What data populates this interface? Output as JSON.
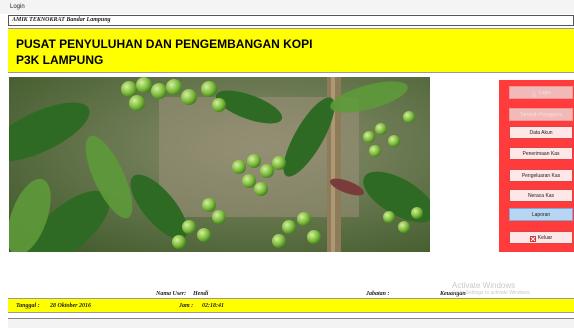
{
  "window": {
    "title": "Login"
  },
  "subtitle": "AMIK TEKNOKRAT Bandar Lampung",
  "banner": {
    "line1": "PUSAT PENYULUHAN DAN PENGEMBANGAN KOPI",
    "line2": "P3K LAMPUNG"
  },
  "menu": {
    "items": [
      {
        "label": "Login",
        "state": "disabled",
        "icon": "user-icon"
      },
      {
        "label": "Tambah Pengguna",
        "state": "disabled"
      },
      {
        "label": "Data Akun",
        "state": "normal"
      },
      {
        "label": "Penerimaan Kas",
        "state": "normal"
      },
      {
        "label": "Pengeluaran Kas",
        "state": "normal"
      },
      {
        "label": "Neraca Kas",
        "state": "normal"
      },
      {
        "label": "Laporan",
        "state": "active"
      },
      {
        "label": "Keluar",
        "state": "normal",
        "icon": "close-icon"
      }
    ]
  },
  "info": {
    "user_label": "Nama User:",
    "user_value": "Hendi",
    "jabatan_label": "Jabatan :",
    "jabatan_value": "Keuangan"
  },
  "status": {
    "tanggal_label": "Tanggal :",
    "tanggal_value": "28 Oktober 2016",
    "jam_label": "Jam :",
    "jam_value": "02:18:41"
  },
  "watermark": {
    "title": "Activate Windows",
    "sub": "Go to Settings to activate Windows."
  },
  "colors": {
    "banner": "#ffff00",
    "menu_panel": "#ff3b3b",
    "active_button": "#b7d6f3"
  }
}
